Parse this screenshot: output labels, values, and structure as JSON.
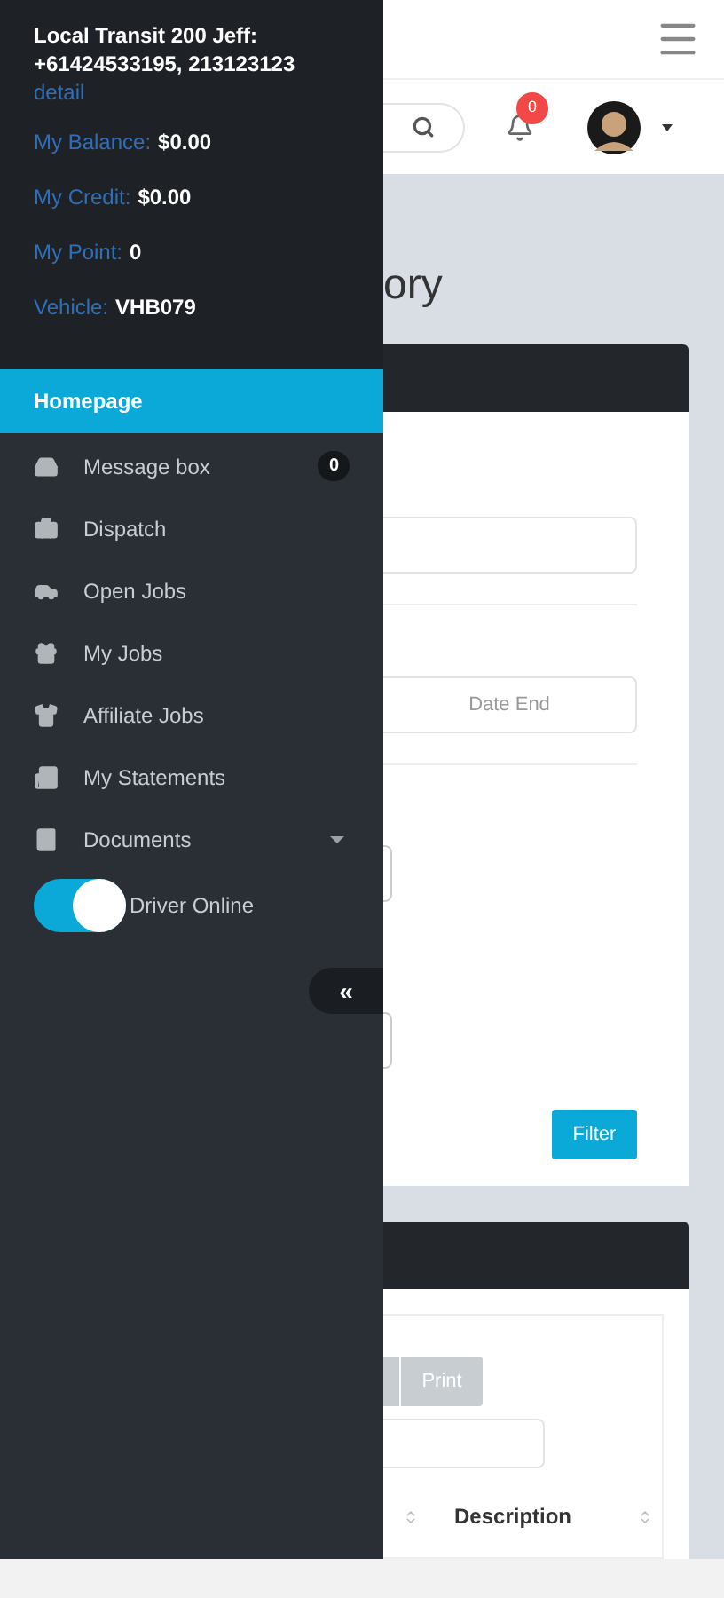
{
  "sidebar": {
    "account": {
      "name": "Local Transit 200 Jeff:",
      "phones": "+61424533195, 213123123",
      "link": "detail"
    },
    "stats": [
      {
        "label": "My Balance:",
        "value": "$0.00"
      },
      {
        "label": "My Credit:",
        "value": "$0.00"
      },
      {
        "label": "My Point:",
        "value": "0"
      },
      {
        "label": "Vehicle:",
        "value": "VHB079"
      }
    ],
    "menu": [
      {
        "label": "Homepage",
        "selected": true
      },
      {
        "label": "Message box",
        "selected": false,
        "badge": "0"
      },
      {
        "label": "Dispatch",
        "selected": false
      },
      {
        "label": "Open Jobs",
        "selected": false
      },
      {
        "label": "My Jobs",
        "selected": false
      },
      {
        "label": "Affiliate Jobs",
        "selected": false
      },
      {
        "label": "My Statements",
        "selected": false
      },
      {
        "label": "Documents",
        "selected": false,
        "expandable": true
      }
    ],
    "driver_toggle": {
      "label": "Driver Online",
      "on": true
    },
    "collapse_button": "«"
  },
  "topbar": {
    "notifications": "0"
  },
  "page_title": "ory",
  "filter_card": {
    "date_end_placeholder": "Date End",
    "button": "Filter"
  },
  "results_card": {
    "print_button": "Print",
    "columns": [
      "Description"
    ]
  }
}
